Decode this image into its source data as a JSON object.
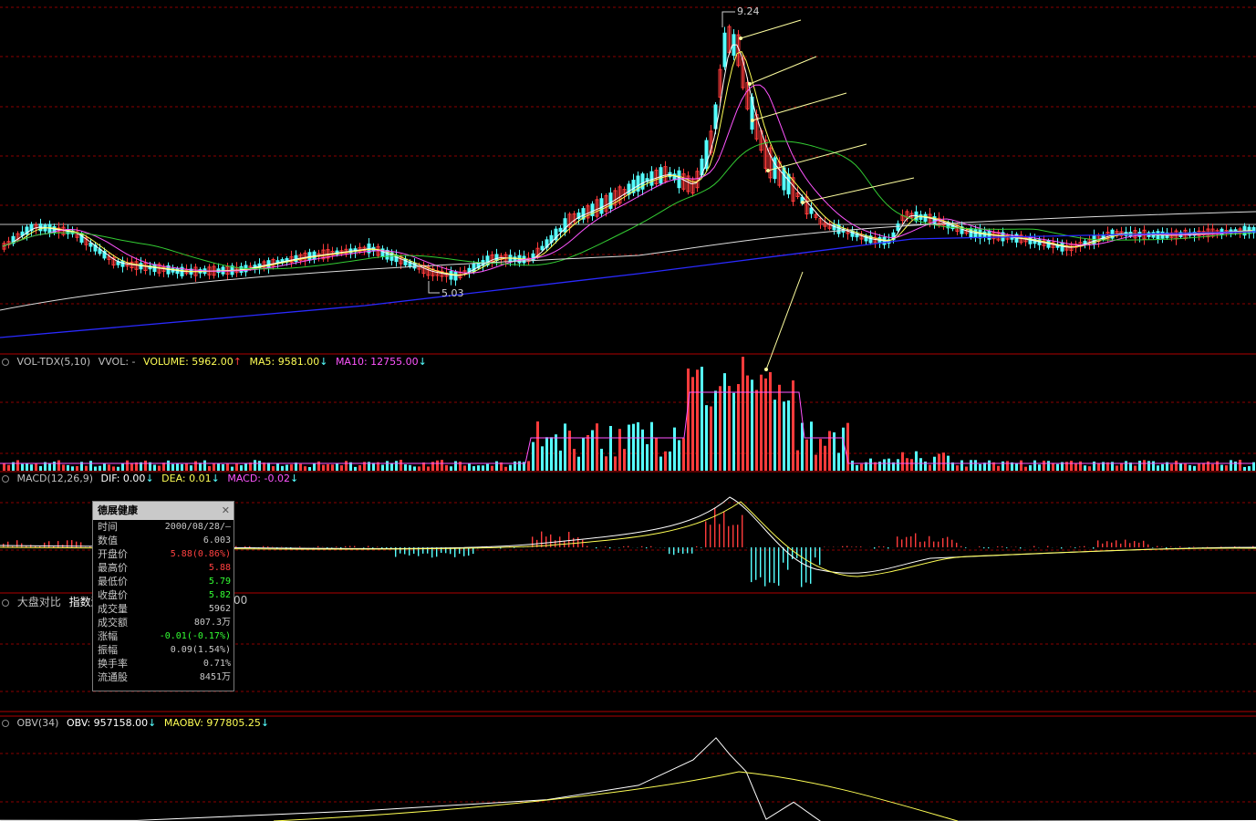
{
  "window": {
    "title": ""
  },
  "colors": {
    "up": "#ff3b3b",
    "down": "#55ffff",
    "ma1": "#ffffff",
    "ma2": "#ffff55",
    "ma3": "#ff55ff",
    "ma4": "#33cc33",
    "ma5": "#dddddd",
    "ma6": "#2a2aff",
    "grid": "#8b0000",
    "arrow": "#ffffa0"
  },
  "main": {
    "high_label": "9.24",
    "low_label": "5.03"
  },
  "volume_panel": {
    "name": "VOL-TDX(5,10)",
    "vvol": "VVOL: -",
    "volume": "VOLUME: 5962.00",
    "volume_arrow": "↑",
    "ma5": "MA5: 9581.00",
    "ma5_arrow": "↓",
    "ma10": "MA10: 12755.00",
    "ma10_arrow": "↓"
  },
  "macd_panel": {
    "name": "MACD(12,26,9)",
    "dif": "DIF: 0.00",
    "dif_arrow": "↓",
    "dea": "DEA: 0.01",
    "dea_arrow": "↓",
    "macd": "MACD: -0.02",
    "macd_arrow": "↓"
  },
  "compare_panel": {
    "name": "大盘对比",
    "label": "指数涨",
    "value_tail": "00"
  },
  "obv_panel": {
    "name": "OBV(34)",
    "obv": "OBV: 957158.00",
    "obv_arrow": "↓",
    "maobv": "MAOBV: 977805.25",
    "maobv_arrow": "↓"
  },
  "tooltip": {
    "title": "德展健康",
    "close_icon": "close-icon",
    "rows": [
      {
        "key": "时间",
        "value": "2000/08/28/—",
        "color": "#c8c8c8"
      },
      {
        "key": "数值",
        "value": "6.003",
        "color": "#c8c8c8"
      },
      {
        "key": "开盘价",
        "value": "5.88(0.86%)",
        "color": "#ff4040"
      },
      {
        "key": "最高价",
        "value": "5.88",
        "color": "#ff4040"
      },
      {
        "key": "最低价",
        "value": "5.79",
        "color": "#33ff33"
      },
      {
        "key": "收盘价",
        "value": "5.82",
        "color": "#33ff33"
      },
      {
        "key": "成交量",
        "value": "5962",
        "color": "#c8c8c8"
      },
      {
        "key": "成交额",
        "value": "807.3万",
        "color": "#c8c8c8"
      },
      {
        "key": "涨幅",
        "value": "-0.01(-0.17%)",
        "color": "#33ff33"
      },
      {
        "key": "振幅",
        "value": "0.09(1.54%)",
        "color": "#c8c8c8"
      },
      {
        "key": "换手率",
        "value": "0.71%",
        "color": "#c8c8c8"
      },
      {
        "key": "流通股",
        "value": "8451万",
        "color": "#c8c8c8"
      }
    ]
  }
}
